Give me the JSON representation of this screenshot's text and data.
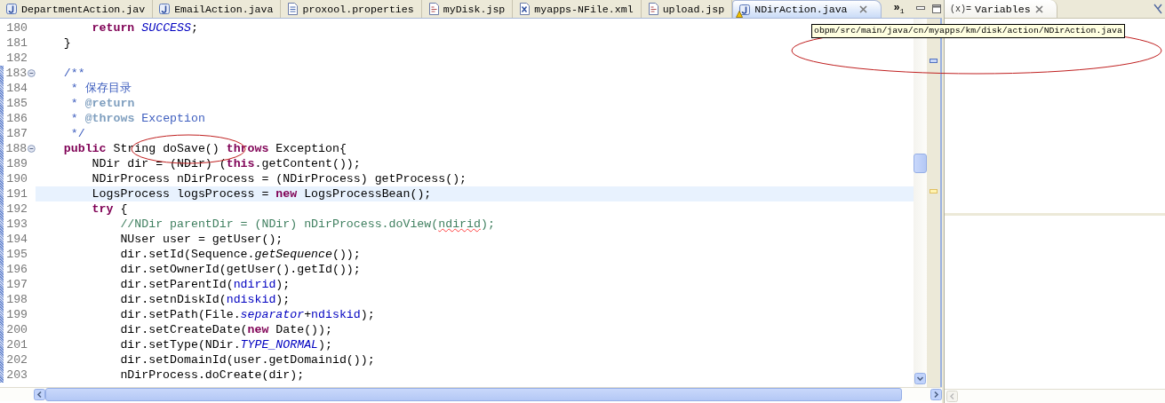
{
  "editor_tabs": [
    {
      "label": "DepartmentAction.jav",
      "kind": "java",
      "selected": false,
      "warning": false
    },
    {
      "label": "EmailAction.java",
      "kind": "java",
      "selected": false,
      "warning": false
    },
    {
      "label": "proxool.properties",
      "kind": "properties",
      "selected": false,
      "warning": false
    },
    {
      "label": "myDisk.jsp",
      "kind": "jsp",
      "selected": false,
      "warning": false
    },
    {
      "label": "myapps-NFile.xml",
      "kind": "xml",
      "selected": false,
      "warning": false
    },
    {
      "label": "upload.jsp",
      "kind": "jsp",
      "selected": false,
      "warning": false
    },
    {
      "label": "NDirAction.java",
      "kind": "java",
      "selected": true,
      "warning": true
    }
  ],
  "tab_overflow": {
    "symbol": "»",
    "count": "1"
  },
  "code_lines": [
    {
      "number": "180",
      "fold": false,
      "current": false,
      "in_range": false,
      "tokens": [
        {
          "kind": "keyword",
          "text": "        return"
        },
        {
          "kind": "constant",
          "text": " SUCCESS"
        },
        {
          "kind": "plain",
          "text": ";"
        }
      ]
    },
    {
      "number": "181",
      "fold": false,
      "current": false,
      "in_range": false,
      "tokens": [
        {
          "kind": "plain",
          "text": "    }"
        }
      ]
    },
    {
      "number": "182",
      "fold": false,
      "current": false,
      "in_range": false
    },
    {
      "number": "183",
      "fold": true,
      "current": false,
      "in_range": true,
      "tokens": [
        {
          "kind": "doc",
          "text": "    /**"
        }
      ]
    },
    {
      "number": "184",
      "fold": false,
      "current": false,
      "in_range": true,
      "tokens": [
        {
          "kind": "doc",
          "text": "     * 保存目录"
        }
      ]
    },
    {
      "number": "185",
      "fold": false,
      "current": false,
      "in_range": true,
      "tokens": [
        {
          "kind": "doc",
          "text": "     *"
        },
        {
          "kind": "doctag",
          "text": " @return"
        }
      ]
    },
    {
      "number": "186",
      "fold": false,
      "current": false,
      "in_range": true,
      "tokens": [
        {
          "kind": "doc",
          "text": "     *"
        },
        {
          "kind": "doctag",
          "text": " @throws"
        },
        {
          "kind": "doc",
          "text": " Exception"
        }
      ]
    },
    {
      "number": "187",
      "fold": false,
      "current": false,
      "in_range": true,
      "tokens": [
        {
          "kind": "doc",
          "text": "     */"
        }
      ]
    },
    {
      "number": "188",
      "fold": true,
      "current": false,
      "in_range": true,
      "tokens": [
        {
          "kind": "keyword",
          "text": "    public"
        },
        {
          "kind": "plain",
          "text": " String doSave()"
        },
        {
          "kind": "keyword",
          "text": " throws"
        },
        {
          "kind": "plain",
          "text": " Exception{"
        }
      ]
    },
    {
      "number": "189",
      "fold": false,
      "current": false,
      "in_range": true,
      "tokens": [
        {
          "kind": "plain",
          "text": "        NDir dir = (NDir) ("
        },
        {
          "kind": "keyword",
          "text": "this"
        },
        {
          "kind": "plain",
          "text": ".getContent());"
        }
      ]
    },
    {
      "number": "190",
      "fold": false,
      "current": false,
      "in_range": true,
      "tokens": [
        {
          "kind": "plain",
          "text": "        NDirProcess nDirProcess = (NDirProcess) getProcess();"
        }
      ]
    },
    {
      "number": "191",
      "fold": false,
      "current": true,
      "in_range": true,
      "tokens": [
        {
          "kind": "plain",
          "text": "        LogsProcess logsProcess ="
        },
        {
          "kind": "keyword",
          "text": " new"
        },
        {
          "kind": "plain",
          "text": " LogsProcessBean();"
        }
      ]
    },
    {
      "number": "192",
      "fold": false,
      "current": false,
      "in_range": true,
      "tokens": [
        {
          "kind": "keyword",
          "text": "        try"
        },
        {
          "kind": "plain",
          "text": " {"
        }
      ]
    },
    {
      "number": "193",
      "fold": false,
      "current": false,
      "in_range": true,
      "tokens": [
        {
          "kind": "comment",
          "text": "            //NDir parentDir = (NDir) nDirProcess.doView("
        },
        {
          "kind": "comment",
          "text": "ndirid",
          "misspelled": true
        },
        {
          "kind": "comment",
          "text": ");"
        }
      ]
    },
    {
      "number": "194",
      "fold": false,
      "current": false,
      "in_range": true,
      "tokens": [
        {
          "kind": "plain",
          "text": "            NUser user = getUser();"
        }
      ]
    },
    {
      "number": "195",
      "fold": false,
      "current": false,
      "in_range": true,
      "tokens": [
        {
          "kind": "plain",
          "text": "            dir.setId(Sequence."
        },
        {
          "kind": "static",
          "text": "getSequence"
        },
        {
          "kind": "plain",
          "text": "());"
        }
      ]
    },
    {
      "number": "196",
      "fold": false,
      "current": false,
      "in_range": true,
      "tokens": [
        {
          "kind": "plain",
          "text": "            dir.setOwnerId(getUser().getId());"
        }
      ]
    },
    {
      "number": "197",
      "fold": false,
      "current": false,
      "in_range": true,
      "tokens": [
        {
          "kind": "plain",
          "text": "            dir.setParentId("
        },
        {
          "kind": "field",
          "text": "ndirid"
        },
        {
          "kind": "plain",
          "text": ");"
        }
      ]
    },
    {
      "number": "198",
      "fold": false,
      "current": false,
      "in_range": true,
      "tokens": [
        {
          "kind": "plain",
          "text": "            dir.setnDiskId("
        },
        {
          "kind": "field",
          "text": "ndiskid"
        },
        {
          "kind": "plain",
          "text": ");"
        }
      ]
    },
    {
      "number": "199",
      "fold": false,
      "current": false,
      "in_range": true,
      "tokens": [
        {
          "kind": "plain",
          "text": "            dir.setPath(File."
        },
        {
          "kind": "constant",
          "text": "separator"
        },
        {
          "kind": "plain",
          "text": "+"
        },
        {
          "kind": "field",
          "text": "ndiskid"
        },
        {
          "kind": "plain",
          "text": ");"
        }
      ]
    },
    {
      "number": "200",
      "fold": false,
      "current": false,
      "in_range": true,
      "tokens": [
        {
          "kind": "plain",
          "text": "            dir.setCreateDate("
        },
        {
          "kind": "keyword",
          "text": "new"
        },
        {
          "kind": "plain",
          "text": " Date());"
        }
      ]
    },
    {
      "number": "201",
      "fold": false,
      "current": false,
      "in_range": true,
      "tokens": [
        {
          "kind": "plain",
          "text": "            dir.setType(NDir."
        },
        {
          "kind": "constant",
          "text": "TYPE_NORMAL"
        },
        {
          "kind": "plain",
          "text": ");"
        }
      ]
    },
    {
      "number": "202",
      "fold": false,
      "current": false,
      "in_range": true,
      "tokens": [
        {
          "kind": "plain",
          "text": "            dir.setDomainId(user.getDomainid());"
        }
      ]
    },
    {
      "number": "203",
      "fold": false,
      "current": false,
      "in_range": true,
      "tokens": [
        {
          "kind": "plain",
          "text": "            nDirProcess.doCreate(dir);"
        }
      ]
    }
  ],
  "tooltip": "obpm/src/main/java/cn/myapps/km/disk/action/NDirAction.java",
  "annotations": {
    "tooltip_circled": true,
    "method_circled": true
  },
  "variables_view": {
    "icon_text": "(x)=",
    "title": "Variables"
  }
}
